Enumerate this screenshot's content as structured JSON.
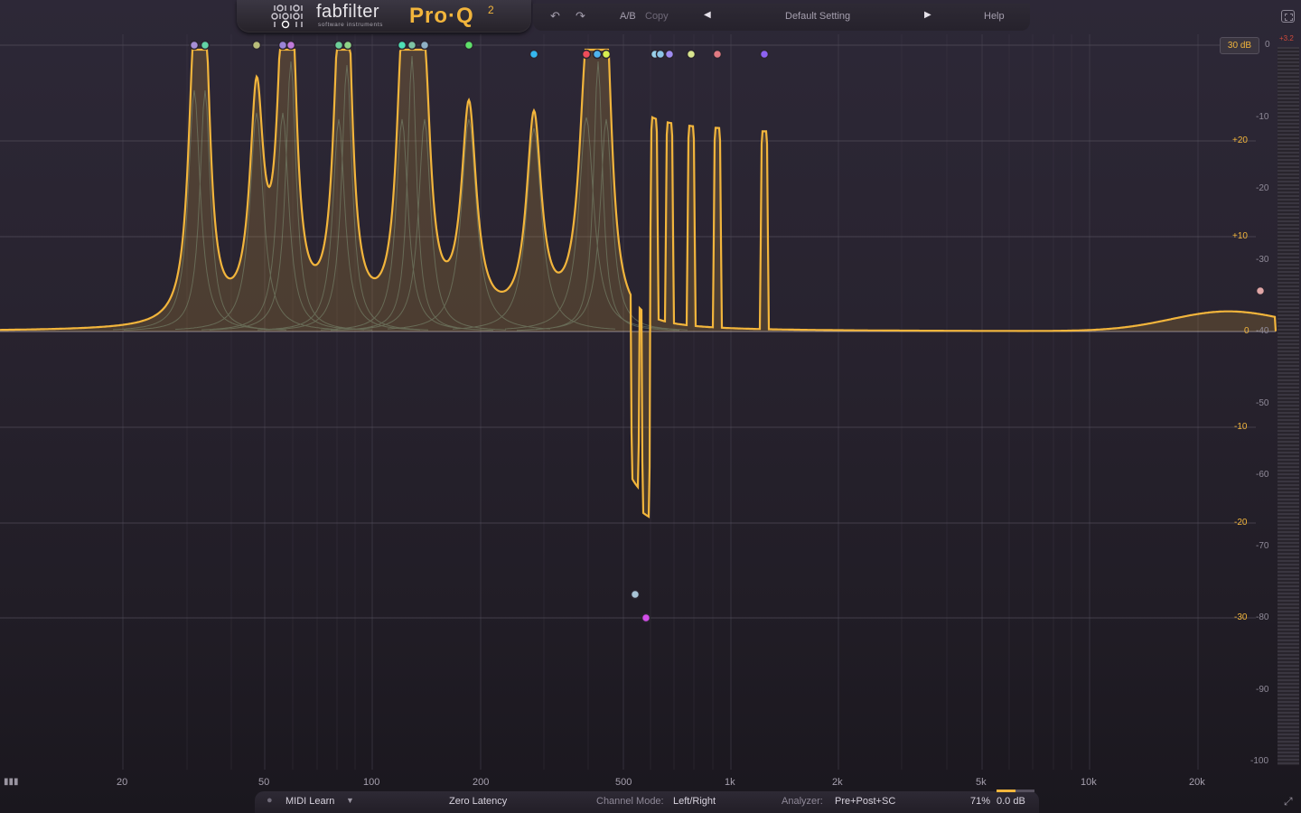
{
  "app": {
    "brand": "fabfilter",
    "brand_sub": "software instruments",
    "product": "Pro·Q",
    "product_version": "2"
  },
  "toolbar": {
    "ab_label": "A/B",
    "copy_label": "Copy",
    "preset_name": "Default Setting",
    "help_label": "Help"
  },
  "display": {
    "range_label": "30 dB",
    "peak_readout": "+3.2",
    "analyzer_scale": [
      "0",
      "-10",
      "-20",
      "-30",
      "-40",
      "-50",
      "-60",
      "-70",
      "-80",
      "-90",
      "-100"
    ],
    "gain_scale": [
      "+20",
      "+10",
      "0",
      "-10",
      "-20",
      "-30"
    ],
    "freq_labels": [
      "20",
      "50",
      "100",
      "200",
      "500",
      "1k",
      "2k",
      "5k",
      "10k",
      "20k"
    ]
  },
  "bands": [
    {
      "color": "#a78fd6"
    },
    {
      "color": "#62d3a6"
    },
    {
      "color": "#b9bd7a"
    },
    {
      "color": "#9b84d6"
    },
    {
      "color": "#c07ad9"
    },
    {
      "color": "#6dcf9a"
    },
    {
      "color": "#8fd487"
    },
    {
      "color": "#4fe0b5"
    },
    {
      "color": "#7fc4a4"
    },
    {
      "color": "#8fb0c4"
    },
    {
      "color": "#5fe06a"
    },
    {
      "color": "#35b7ee"
    },
    {
      "color": "#ef4d5a"
    },
    {
      "color": "#4fb4ee"
    },
    {
      "color": "#d7ee4f"
    },
    {
      "color": "#9ad1ea"
    },
    {
      "color": "#8cc5e6"
    },
    {
      "color": "#9f8cf0"
    },
    {
      "color": "#d9e58f"
    },
    {
      "color": "#e07a82"
    },
    {
      "color": "#8d62f2"
    },
    {
      "color": "#a9c4d6"
    },
    {
      "color": "#d24ee8"
    },
    {
      "color": "#e0a6a6"
    }
  ],
  "bottom_bar": {
    "midi_learn": "MIDI Learn",
    "latency": "Zero Latency",
    "channel_mode_label": "Channel Mode:",
    "channel_mode_value": "Left/Right",
    "analyzer_label": "Analyzer:",
    "analyzer_value": "Pre+Post+SC",
    "zoom": "71%",
    "output_gain": "0.0 dB"
  },
  "colors": {
    "curve": "#f2b53c",
    "accent": "#f2b53c"
  }
}
